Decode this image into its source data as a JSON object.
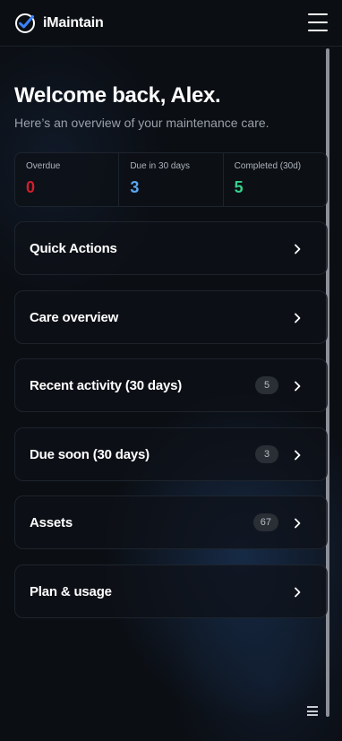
{
  "header": {
    "title": "iMaintain"
  },
  "welcome": {
    "heading": "Welcome back, Alex.",
    "subtitle": "Here’s an overview of your maintenance care."
  },
  "stats": [
    {
      "label": "Overdue",
      "value": "0",
      "color": "#d21f2b"
    },
    {
      "label": "Due in 30 days",
      "value": "3",
      "color": "#5aa5f0"
    },
    {
      "label": "Completed (30d)",
      "value": "5",
      "color": "#37d08c"
    }
  ],
  "cards": [
    {
      "title": "Quick Actions",
      "badge": null
    },
    {
      "title": "Care overview",
      "badge": null
    },
    {
      "title": "Recent activity (30 days)",
      "badge": "5"
    },
    {
      "title": "Due soon (30 days)",
      "badge": "3"
    },
    {
      "title": "Assets",
      "badge": "67"
    },
    {
      "title": "Plan & usage",
      "badge": null
    }
  ],
  "icons": {
    "logo": "check-circle-icon",
    "menu": "hamburger-menu-icon",
    "chevron": "chevron-right-icon",
    "bottom": "list-icon"
  },
  "colors": {
    "accent": "#3b82f6",
    "background": "#0b0e13"
  }
}
